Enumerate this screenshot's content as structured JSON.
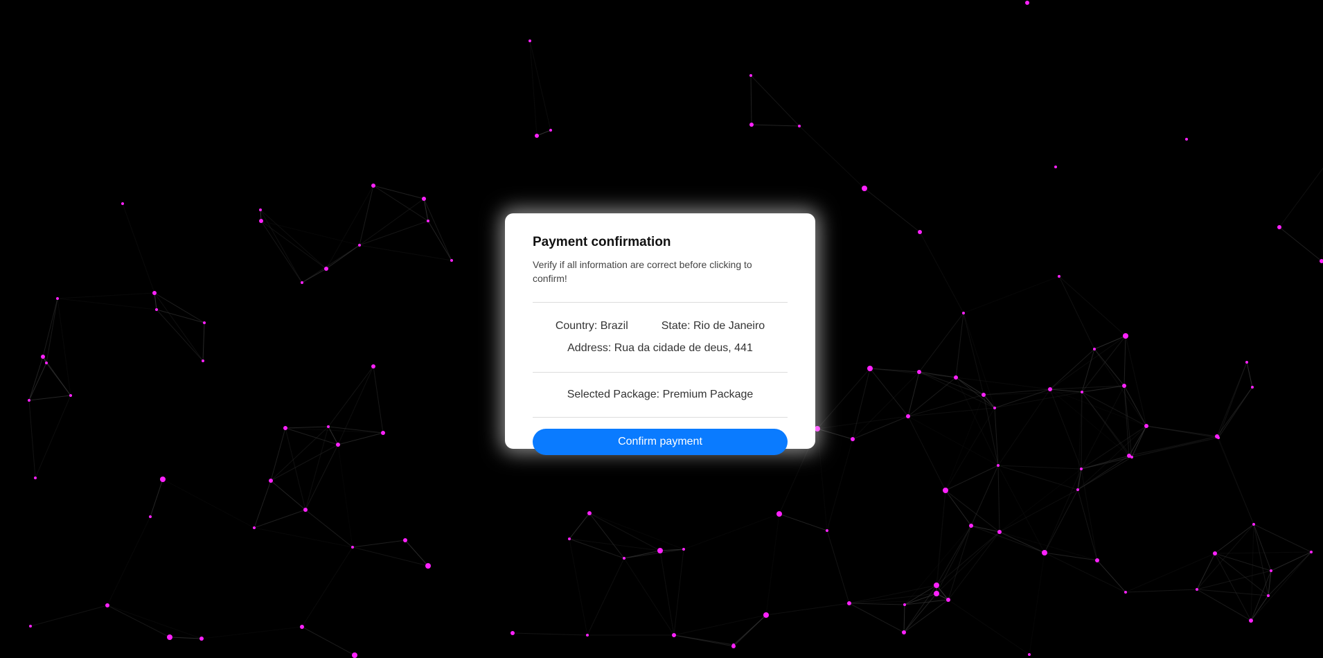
{
  "modal": {
    "title": "Payment confirmation",
    "subtitle": "Verify if all information are correct before clicking to confirm!",
    "country": "Country: Brazil",
    "state": "State: Rio de Janeiro",
    "address": "Address: Rua da cidade de deus, 441",
    "package": "Selected Package: Premium Package",
    "confirm_label": "Confirm payment"
  },
  "colors": {
    "background": "#000000",
    "node": "#ff22ff",
    "edge": "#3a3a3a",
    "button": "#0a7bff",
    "card": "#ffffff"
  }
}
